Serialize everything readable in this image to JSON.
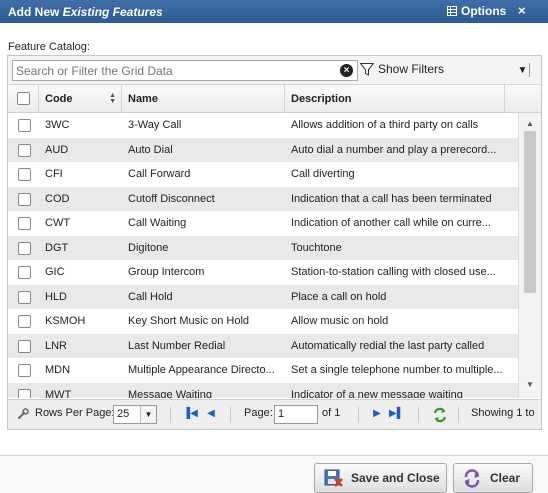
{
  "window": {
    "title_plain": "Add New ",
    "title_italic": "Existing Features",
    "options_label": "Options",
    "close_symbol": "×",
    "accent_color": "#356399"
  },
  "catalog_label": "Feature Catalog:",
  "toolbar": {
    "search_placeholder": "Search or Filter the Grid Data",
    "show_filters_label": "Show Filters"
  },
  "columns": {
    "code": "Code",
    "name": "Name",
    "description": "Description"
  },
  "rows": [
    {
      "code": "3WC",
      "name": "3-Way Call",
      "description": "Allows addition of a third party on calls"
    },
    {
      "code": "AUD",
      "name": "Auto Dial",
      "description": "Auto dial a number and play a prerecord..."
    },
    {
      "code": "CFI",
      "name": "Call Forward",
      "description": "Call diverting"
    },
    {
      "code": "COD",
      "name": "Cutoff Disconnect",
      "description": "Indication that a call has been terminated"
    },
    {
      "code": "CWT",
      "name": "Call Waiting",
      "description": "Indication of another call while on curre..."
    },
    {
      "code": "DGT",
      "name": "Digitone",
      "description": "Touchtone"
    },
    {
      "code": "GIC",
      "name": "Group Intercom",
      "description": "Station-to-station calling with closed use..."
    },
    {
      "code": "HLD",
      "name": "Call Hold",
      "description": "Place a call on hold"
    },
    {
      "code": "KSMOH",
      "name": "Key Short Music on Hold",
      "description": "Allow music on hold"
    },
    {
      "code": "LNR",
      "name": "Last Number Redial",
      "description": "Automatically redial the last party called"
    },
    {
      "code": "MDN",
      "name": "Multiple Appearance Directo...",
      "description": "Set a single telephone number to multiple..."
    },
    {
      "code": "MWT",
      "name": "Message Waiting",
      "description": "Indicator of a new message waiting"
    }
  ],
  "pager": {
    "rows_per_page_label": "Rows Per Page:",
    "rows_per_page_value": "25",
    "page_label": "Page:",
    "page_value": "1",
    "of_label": "of 1",
    "showing_text": "Showing 1 to"
  },
  "footer": {
    "save_close_label": "Save and Close",
    "clear_label": "Clear"
  },
  "icons": {
    "options": "grid-options-icon",
    "filter": "funnel-icon",
    "first": "first-page-icon",
    "prev": "prev-page-icon",
    "next": "next-page-icon",
    "last": "last-page-icon",
    "refresh": "refresh-icon",
    "rows_per_page": "wrench-icon"
  }
}
